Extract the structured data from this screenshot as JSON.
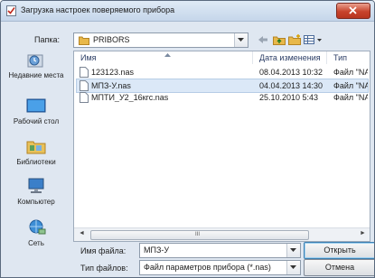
{
  "window": {
    "title": "Загрузка настроек поверяемого прибора",
    "close_icon": "close-icon"
  },
  "lookin": {
    "label": "Папка:",
    "value": "PRIBORS"
  },
  "places": [
    {
      "label": "Недавние места",
      "icon": "recent-places-icon"
    },
    {
      "label": "Рабочий стол",
      "icon": "desktop-icon"
    },
    {
      "label": "Библиотеки",
      "icon": "libraries-icon"
    },
    {
      "label": "Компьютер",
      "icon": "computer-icon"
    },
    {
      "label": "Сеть",
      "icon": "network-icon"
    }
  ],
  "columns": {
    "name": "Имя",
    "date": "Дата изменения",
    "type": "Тип"
  },
  "files": [
    {
      "name": "123123.nas",
      "date": "08.04.2013 10:32",
      "type": "Файл \"NA"
    },
    {
      "name": "МПЗ-У.nas",
      "date": "04.04.2013 14:30",
      "type": "Файл \"NA"
    },
    {
      "name": "МПТИ_У2_16кгс.nas",
      "date": "25.10.2010 5:43",
      "type": "Файл \"NA"
    }
  ],
  "selected_index": 1,
  "filename": {
    "label": "Имя файла:",
    "value": "МПЗ-У"
  },
  "filetype": {
    "label": "Тип файлов:",
    "value": "Файл параметров прибора (*.nas)"
  },
  "buttons": {
    "open": "Открыть",
    "cancel": "Отмена"
  },
  "colors": {
    "title_bar": "#c5d6ea",
    "close": "#c8442c",
    "selection": "#dbe8f7",
    "folder": "#e8b84a"
  }
}
